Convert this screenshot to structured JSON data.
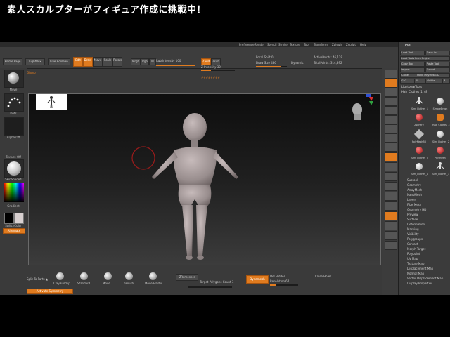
{
  "banner": {
    "title": "素人スカルプターがフィギュア作成に挑戦中！"
  },
  "menu": {
    "items": [
      "Preferences",
      "Render",
      "Stencil",
      "Stroke",
      "Texture",
      "Tool",
      "Transform",
      "Zplugin",
      "Zscript",
      "Help"
    ]
  },
  "top_shelf": {
    "buttons": [
      "Home Page",
      "LightBox",
      "Live Boolean",
      "Edit",
      "Draw",
      "Move",
      "Scale",
      "Rotate"
    ],
    "mrgb_label": "Mrgb",
    "rgb_label": "Rgb",
    "m_label": "M",
    "zadd_label": "Zadd",
    "zsub_label": "Zsub",
    "focal_shift": "Focal Shift 0",
    "draw_size": "Draw Size 486",
    "dynamic": "Dynamic",
    "rgb_intensity": "Rgb Intensity 100",
    "z_intensity": "Z Intensity 30",
    "active_points": "ActivePoints: 46,129",
    "total_points": "TotalPoints: 314,392",
    "doc_label": "Gizmo",
    "center_text": "########"
  },
  "left_shelf": {
    "brush_label": "Move",
    "stroke_label": "Dots",
    "alpha_label": "Alpha Off",
    "texture_label": "Texture Off",
    "material_label": "SkinShade4",
    "gradient_label": "Gradient",
    "switch_label": "SwitchColor",
    "alternate_label": "Alternate"
  },
  "bottom_shelf": {
    "split_label": "Split To Parts ▲",
    "brushes": [
      "ClayBuildup",
      "Standard",
      "Move",
      "hPolish",
      "Move Elastic"
    ],
    "dynamesh_label": "Dynamesh",
    "target_label": "Target Polygons Count 3",
    "del_hidden": "Del Hidden",
    "resolution": "Resolution 64",
    "close_holes": "Close Holes",
    "zremesher": "ZRemesher",
    "activate_sym": "Activate Symmetry"
  },
  "right_shelf": {
    "buttons": [
      "BPR",
      "SPix 3",
      "Scroll",
      "Zoom",
      "Actual",
      "AAHalf",
      "Persp",
      "Floor",
      "L.Sym",
      "XYZ",
      "Frame",
      "Move",
      "Scale",
      "Rotate",
      "Line Fill",
      "PolyF",
      "Transp",
      "Solo",
      "Xpose"
    ]
  },
  "tool_panel": {
    "title": "Tool",
    "buttons": [
      "Load Tool",
      "Save As",
      "Load Tools From Project",
      "Copy Tool",
      "Paste Tool",
      "Import",
      "Export",
      "Clone",
      "Make PolyMesh3D",
      "GoZ",
      "All",
      "Visible",
      "R"
    ],
    "lightbox_label": "Lightbox▸Tools",
    "current_tool": "Hair_Clothes_1_48",
    "tools": [
      "Hair_Clothes",
      "Cylinder3D",
      "Sim_Clothes_1",
      "SimpleBrush",
      "Hair_Clothes_3",
      "Zsphere",
      "PolyMesh3D",
      "Sim_Clothes_2",
      "Sim_Clothes_5",
      "PolyMesh",
      "Sim_Clothes_4",
      "Sim_Clothes_3",
      "Sim_Clothes_2"
    ],
    "sections": [
      "Subtool",
      "Geometry",
      "ArrayMesh",
      "NanoMesh",
      "Layers",
      "FiberMesh",
      "Geometry HD",
      "Preview",
      "Surface",
      "Deformation",
      "Masking",
      "Visibility",
      "Polygroups",
      "Contact",
      "Morph Target",
      "Polypaint",
      "UV Map",
      "Texture Map",
      "Displacement Map",
      "Normal Map",
      "Vector Displacement Map",
      "Display Properties"
    ]
  },
  "colors": {
    "accent": "#e07b1f",
    "panel": "#3a3a3a",
    "canvas_top": "#0d0d0d",
    "canvas_bottom": "#444444"
  }
}
